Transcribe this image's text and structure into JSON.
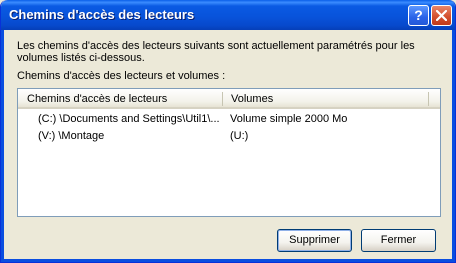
{
  "window": {
    "title": "Chemins d'accès des lecteurs",
    "help_glyph": "?",
    "close_icon": "close-icon"
  },
  "description": "Les chemins d'accès des lecteurs suivants sont actuellement paramétrés pour les volumes listés ci-dessous.",
  "list_label": "Chemins d'accès des lecteurs et volumes :",
  "list": {
    "columns": [
      "Chemins d'accès de lecteurs",
      "Volumes"
    ],
    "rows": [
      {
        "path": "(C:) \\Documents and Settings\\Util1\\...",
        "volume": "Volume simple  2000 Mo"
      },
      {
        "path": "(V:) \\Montage",
        "volume": "(U:)"
      }
    ]
  },
  "buttons": {
    "remove": "Supprimer",
    "close": "Fermer"
  }
}
